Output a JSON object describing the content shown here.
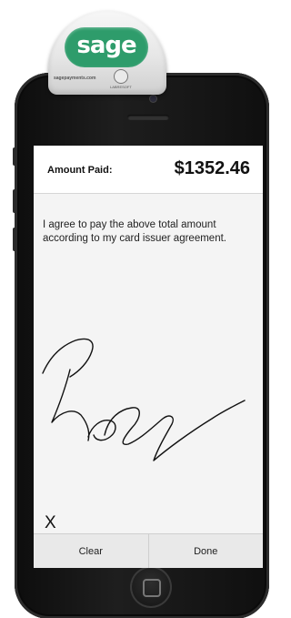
{
  "reader": {
    "brand": "sage",
    "url": "sagepayments.com",
    "seal_text": "LABRESOFT"
  },
  "payment": {
    "amount_label": "Amount Paid:",
    "amount_value": "$1352.46"
  },
  "agreement_text": "I agree to pay the above total amount according to my card issuer agreement.",
  "signature": {
    "marker": "X"
  },
  "actions": {
    "clear_label": "Clear",
    "done_label": "Done"
  },
  "colors": {
    "brand_green": "#2e9c6b",
    "screen_bg": "#f4f4f4",
    "button_bar": "#e9e9e9"
  }
}
